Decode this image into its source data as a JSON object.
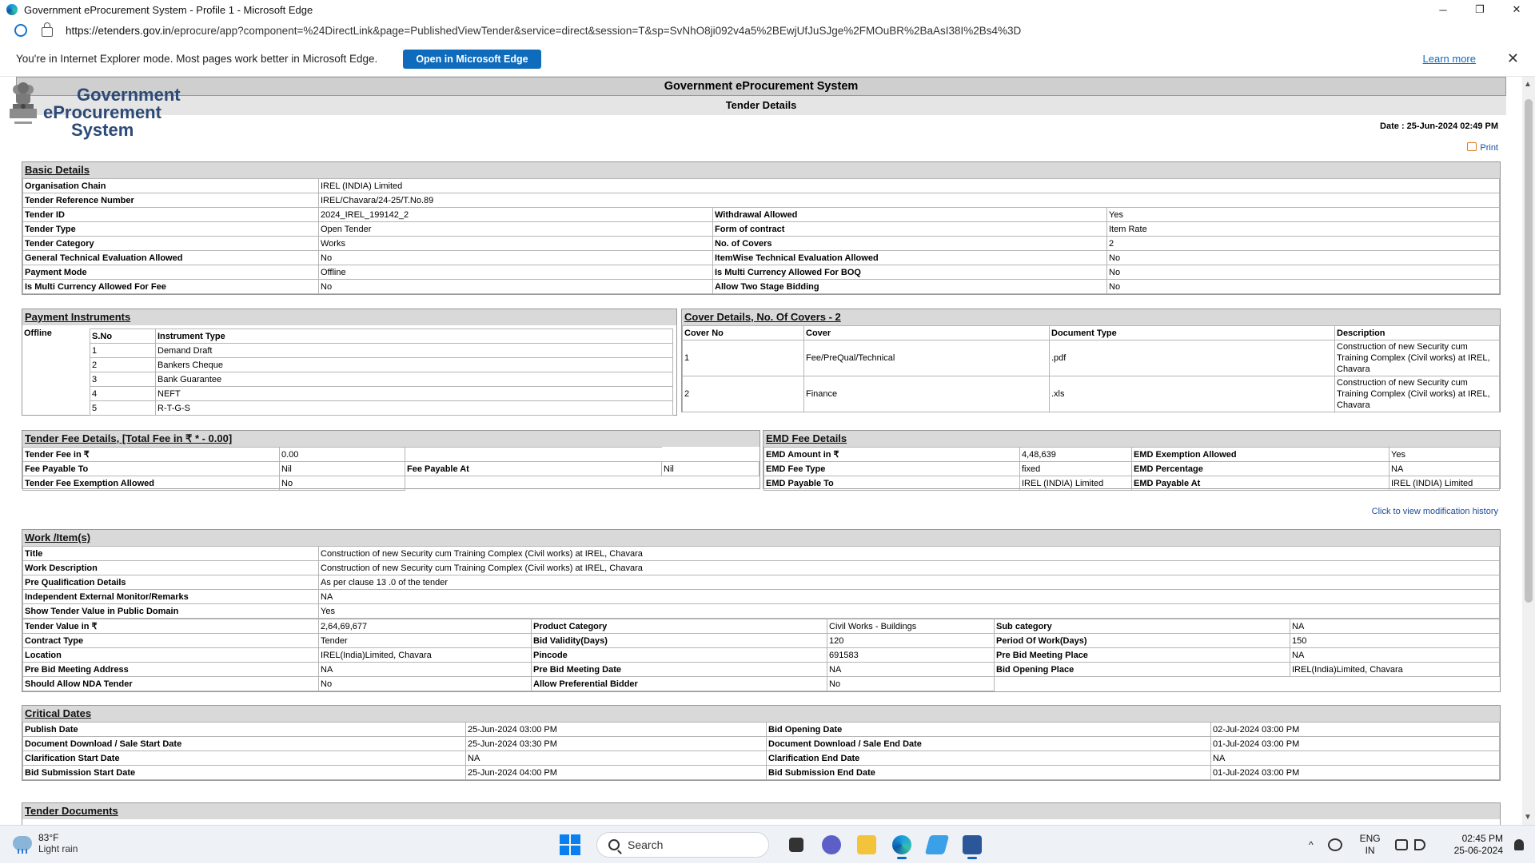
{
  "window": {
    "title": "Government eProcurement System - Profile 1 - Microsoft Edge",
    "min": "─",
    "max": "❐",
    "close": "✕"
  },
  "address": {
    "host": "https://etenders.gov.in",
    "path": "/eprocure/app?component=%24DirectLink&page=PublishedViewTender&service=direct&session=T&sp=SvNhO8ji092v4a5%2BEwjUfJuSJge%2FMOuBR%2BaAsI38I%2Bs4%3D"
  },
  "infobar": {
    "message": "You're in Internet Explorer mode. Most pages work better in Microsoft Edge.",
    "open_button": "Open in Microsoft Edge",
    "learn_more": "Learn more",
    "close": "✕"
  },
  "logo": {
    "line1": "Government",
    "line2": "eProcurement",
    "line3": "System"
  },
  "header": {
    "title": "Government eProcurement System",
    "subtitle": "Tender Details",
    "date": "Date : 25-Jun-2024 02:49 PM",
    "print": "Print"
  },
  "basic": {
    "heading": "Basic Details",
    "org_label": "Organisation Chain",
    "org_value": "IREL (INDIA) Limited",
    "ref_label": "Tender Reference Number",
    "ref_value": "IREL/Chavara/24-25/T.No.89",
    "rows": [
      [
        "Tender ID",
        "2024_IREL_199142_2",
        "Withdrawal Allowed",
        "Yes"
      ],
      [
        "Tender Type",
        "Open Tender",
        "Form of contract",
        "Item Rate"
      ],
      [
        "Tender Category",
        "Works",
        "No. of Covers",
        "2"
      ],
      [
        "General Technical Evaluation Allowed",
        "No",
        "ItemWise Technical Evaluation Allowed",
        "No"
      ],
      [
        "Payment Mode",
        "Offline",
        "Is Multi Currency Allowed For BOQ",
        "No"
      ],
      [
        "Is Multi Currency Allowed For Fee",
        "No",
        "Allow Two Stage Bidding",
        "No"
      ]
    ]
  },
  "payment": {
    "heading": "Payment Instruments",
    "mode": "Offline",
    "h_sno": "S.No",
    "h_type": "Instrument Type",
    "items": [
      [
        "1",
        "Demand Draft"
      ],
      [
        "2",
        "Bankers Cheque"
      ],
      [
        "3",
        "Bank Guarantee"
      ],
      [
        "4",
        "NEFT"
      ],
      [
        "5",
        "R-T-G-S"
      ]
    ]
  },
  "covers": {
    "heading": "Cover Details, No. Of Covers - 2",
    "headers": [
      "Cover No",
      "Cover",
      "Document Type",
      "Description"
    ],
    "rows": [
      [
        "1",
        "Fee/PreQual/Technical",
        ".pdf",
        "Construction of new Security cum Training Complex (Civil works) at IREL, Chavara"
      ],
      [
        "2",
        "Finance",
        ".xls",
        "Construction of new Security cum Training Complex (Civil works) at IREL, Chavara"
      ]
    ]
  },
  "tenderfee": {
    "heading": "Tender Fee Details, [Total Fee in ₹ * - 0.00]",
    "fee_label": "Tender Fee in ₹",
    "fee_value": "0.00",
    "payto_label": "Fee Payable To",
    "payto_value": "Nil",
    "payat_label": "Fee Payable At",
    "payat_value": "Nil",
    "exempt_label": "Tender Fee Exemption Allowed",
    "exempt_value": "No"
  },
  "emd": {
    "heading": "EMD Fee Details",
    "rows": [
      [
        "EMD Amount in ₹",
        "4,48,639",
        "EMD Exemption Allowed",
        "Yes"
      ],
      [
        "EMD Fee Type",
        "fixed",
        "EMD Percentage",
        "NA"
      ],
      [
        "EMD Payable To",
        "IREL (INDIA) Limited",
        "EMD Payable At",
        "IREL (INDIA) Limited"
      ]
    ]
  },
  "modlink": "Click to view modification history",
  "work": {
    "heading": "Work /Item(s)",
    "single": [
      [
        "Title",
        "Construction of new Security cum Training Complex (Civil works) at IREL, Chavara"
      ],
      [
        "Work Description",
        "Construction of new Security cum Training Complex (Civil works) at IREL, Chavara"
      ],
      [
        "Pre Qualification Details",
        "As per clause 13 .0 of the tender"
      ],
      [
        "Independent External Monitor/Remarks",
        "NA"
      ],
      [
        "Show Tender Value in Public Domain",
        "Yes"
      ]
    ],
    "multi": [
      [
        "Tender Value in ₹",
        "2,64,69,677",
        "Product Category",
        "Civil Works - Buildings",
        "Sub category",
        "NA"
      ],
      [
        "Contract Type",
        "Tender",
        "Bid Validity(Days)",
        "120",
        "Period Of Work(Days)",
        "150"
      ],
      [
        "Location",
        "IREL(India)Limited, Chavara",
        "Pincode",
        "691583",
        "Pre Bid Meeting Place",
        "NA"
      ],
      [
        "Pre Bid Meeting Address",
        "NA",
        "Pre Bid Meeting Date",
        "NA",
        "Bid Opening Place",
        "IREL(India)Limited, Chavara"
      ],
      [
        "Should Allow NDA Tender",
        "No",
        "Allow Preferential Bidder",
        "No",
        "",
        ""
      ]
    ]
  },
  "dates": {
    "heading": "Critical Dates",
    "rows": [
      [
        "Publish Date",
        "25-Jun-2024 03:00 PM",
        "Bid Opening Date",
        "02-Jul-2024 03:00 PM"
      ],
      [
        "Document Download / Sale Start Date",
        "25-Jun-2024 03:30 PM",
        "Document Download / Sale End Date",
        "01-Jul-2024 03:00 PM"
      ],
      [
        "Clarification Start Date",
        "NA",
        "Clarification End Date",
        "NA"
      ],
      [
        "Bid Submission Start Date",
        "25-Jun-2024 04:00 PM",
        "Bid Submission End Date",
        "01-Jul-2024 03:00 PM"
      ]
    ]
  },
  "docs": {
    "heading": "Tender Documents"
  },
  "taskbar": {
    "temp": "83°F",
    "weather": "Light rain",
    "search": "Search",
    "lang1": "ENG",
    "lang2": "IN",
    "time": "02:45 PM",
    "date": "25-06-2024",
    "chev": "^"
  },
  "colors": {
    "accent": "#0f6cbd",
    "section_header": "#d9d9d9",
    "logo_text": "#2c4a76",
    "link": "#1a4a9a"
  }
}
